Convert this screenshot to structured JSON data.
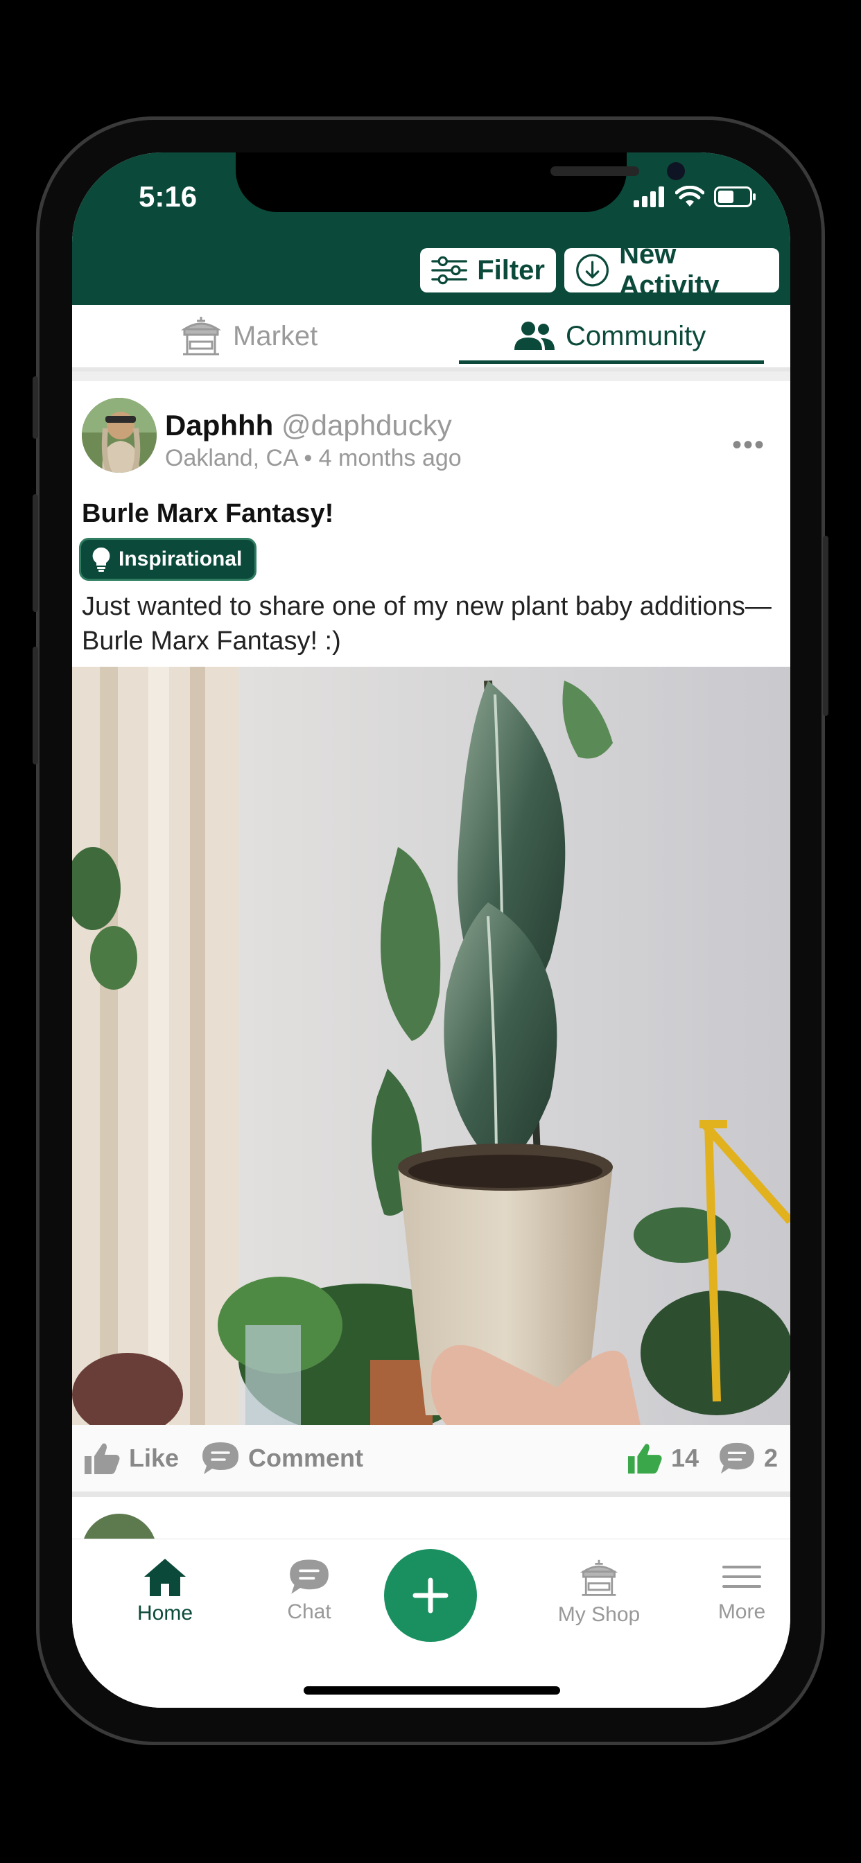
{
  "status_bar": {
    "time": "5:16"
  },
  "header": {
    "filter_label": "Filter",
    "new_activity_label": "New Activity"
  },
  "tabs": [
    {
      "label": "Market",
      "active": false,
      "icon": "market-stall-icon"
    },
    {
      "label": "Community",
      "active": true,
      "icon": "people-icon"
    }
  ],
  "post": {
    "author_name": "Daphhh",
    "author_handle": "@daphducky",
    "meta": "Oakland, CA • 4 months ago",
    "title": "Burle Marx Fantasy!",
    "badge": "Inspirational",
    "text": "Just wanted to share one of my new plant baby additions—Burle Marx Fantasy! :)",
    "like_label": "Like",
    "comment_label": "Comment",
    "like_count": "14",
    "comment_count": "2"
  },
  "bottom_nav": [
    {
      "label": "Home",
      "active": true,
      "icon": "home-icon"
    },
    {
      "label": "Chat",
      "active": false,
      "icon": "chat-icon"
    },
    {
      "label": "",
      "icon": "plus-icon"
    },
    {
      "label": "My Shop",
      "active": false,
      "icon": "shop-icon"
    },
    {
      "label": "More",
      "active": false,
      "icon": "menu-icon"
    }
  ],
  "colors": {
    "brand_green": "#0b4a3a",
    "fab_green": "#1a9060",
    "like_green": "#3aa84a"
  }
}
